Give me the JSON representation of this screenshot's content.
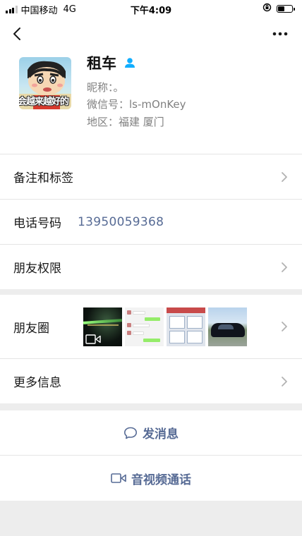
{
  "status_bar": {
    "carrier": "中国移动",
    "network": "4G",
    "time": "下午4:09",
    "signal_bars": 3,
    "battery_level": 0.45
  },
  "header": {
    "back_icon": "chevron-left-icon",
    "more_icon": "ellipsis-icon"
  },
  "profile": {
    "name": "租车",
    "gender_icon": "person-icon",
    "gender_icon_color": "#10aeff",
    "nickname": "昵称：。",
    "wechat_id": "微信号：ls-mOnKey",
    "region": "地区：福建  厦门",
    "avatar_caption": "会越来越好的"
  },
  "rows": {
    "remarks_tags": "备注和标签",
    "phone_label": "电话号码",
    "phone_value": "13950059368",
    "friend_permissions": "朋友权限",
    "moments": "朋友圈",
    "more_info": "更多信息"
  },
  "actions": {
    "send_message": "发消息",
    "video_call": "音视频通话"
  },
  "colors": {
    "link": "#576b95",
    "background": "#ededed"
  }
}
